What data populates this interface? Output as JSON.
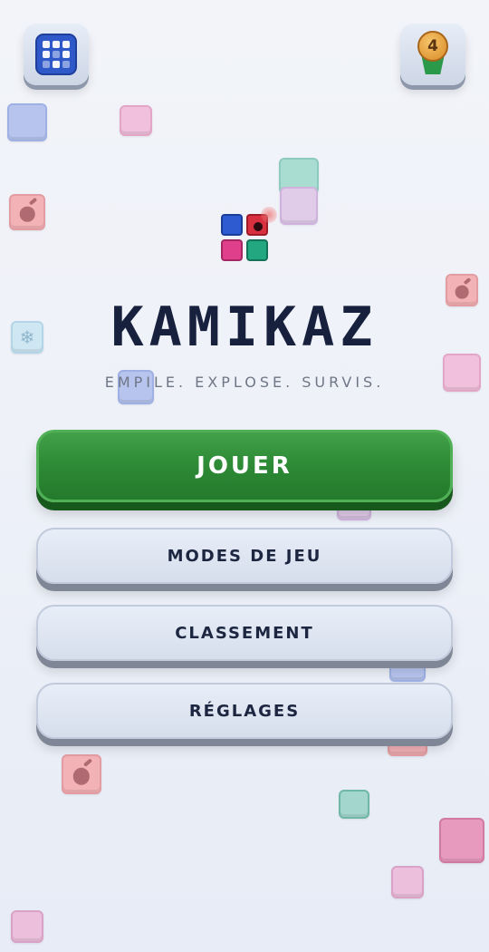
{
  "header": {
    "left_button_icon": "grid-icon",
    "badge_icon": "medal-icon",
    "badge_level": "4"
  },
  "title": "KAMIKAZ",
  "subtitle": "EMPILE. EXPLOSE. SURVIS.",
  "menu": {
    "play_label": "JOUER",
    "modes_label": "MODES DE JEU",
    "ranking_label": "CLASSEMENT",
    "settings_label": "RÉGLAGES"
  },
  "colors": {
    "play_button": "#2e8b36",
    "title_text": "#17213d",
    "secondary_button": "#dde4f0",
    "logo_blue": "#2f5bd0",
    "logo_red": "#d9303f",
    "logo_pink": "#e0408b",
    "logo_green": "#23a780"
  }
}
